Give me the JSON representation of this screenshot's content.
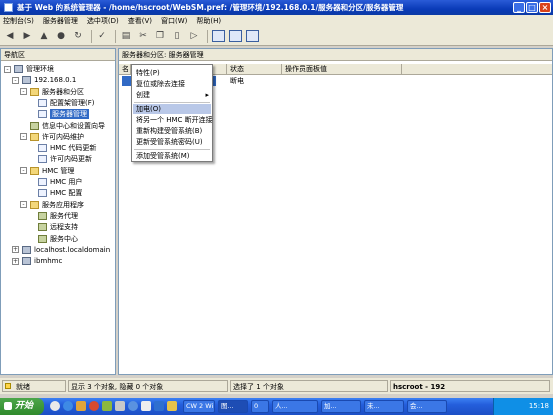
{
  "window": {
    "title": "基于 Web 的系统管理器 - /home/hscroot/WebSM.pref: /管理环境/192.168.0.1/服务器和分区/服务器管理"
  },
  "menubar": [
    "控制台(S)",
    "服务器管理",
    "选中项(D)",
    "查看(V)",
    "窗口(W)",
    "帮助(H)"
  ],
  "left_panel": {
    "header": "导航区",
    "tree": [
      {
        "label": "管理环境",
        "level": 0,
        "toggle": "-",
        "icon": "pc"
      },
      {
        "label": "192.168.0.1",
        "level": 1,
        "toggle": "-",
        "icon": "pc"
      },
      {
        "label": "服务器和分区",
        "level": 2,
        "toggle": "-",
        "icon": "folder"
      },
      {
        "label": "配置架管理(F)",
        "level": 3,
        "toggle": "",
        "icon": "doc"
      },
      {
        "label": "服务器管理",
        "level": 3,
        "toggle": "",
        "icon": "doc",
        "selected": true
      },
      {
        "label": "信息中心和设置向导",
        "level": 2,
        "toggle": "",
        "icon": "tool"
      },
      {
        "label": "许可内码维护",
        "level": 2,
        "toggle": "-",
        "icon": "folder"
      },
      {
        "label": "HMC 代码更新",
        "level": 3,
        "toggle": "",
        "icon": "doc"
      },
      {
        "label": "许可内码更新",
        "level": 3,
        "toggle": "",
        "icon": "doc"
      },
      {
        "label": "HMC 管理",
        "level": 2,
        "toggle": "-",
        "icon": "folder"
      },
      {
        "label": "HMC 用户",
        "level": 3,
        "toggle": "",
        "icon": "doc"
      },
      {
        "label": "HMC 配置",
        "level": 3,
        "toggle": "",
        "icon": "doc"
      },
      {
        "label": "服务应用程序",
        "level": 2,
        "toggle": "-",
        "icon": "folder"
      },
      {
        "label": "服务代理",
        "level": 3,
        "toggle": "",
        "icon": "tool"
      },
      {
        "label": "远程支持",
        "level": 3,
        "toggle": "",
        "icon": "tool"
      },
      {
        "label": "服务中心",
        "level": 3,
        "toggle": "",
        "icon": "tool"
      },
      {
        "label": "localhost.localdomain",
        "level": 1,
        "toggle": "+",
        "icon": "pc"
      },
      {
        "label": "ibmhmc",
        "level": 1,
        "toggle": "+",
        "icon": "pc"
      }
    ]
  },
  "right_panel": {
    "header": "服务器和分区: 服务器管理",
    "columns": [
      "名",
      "",
      "状态",
      "操作员面板值"
    ],
    "rows": [
      {
        "name": "",
        "status": "断电",
        "panel_value": ""
      }
    ]
  },
  "context_menu": [
    {
      "label": "特性(P)",
      "highlight": false,
      "sep_after": false,
      "arrow": false
    },
    {
      "label": "复位或除去连接",
      "highlight": false,
      "sep_after": false,
      "arrow": false
    },
    {
      "label": "创建",
      "highlight": false,
      "sep_after": true,
      "arrow": true
    },
    {
      "label": "加电(O)",
      "highlight": true,
      "sep_after": false,
      "arrow": false
    },
    {
      "label": "将另一个 HMC 断开连接",
      "highlight": false,
      "sep_after": false,
      "arrow": false
    },
    {
      "label": "重新构建受管系统(B)",
      "highlight": false,
      "sep_after": false,
      "arrow": false
    },
    {
      "label": "更新受管系统密码(U)",
      "highlight": false,
      "sep_after": true,
      "arrow": false
    },
    {
      "label": "添加受管系统(M)",
      "highlight": false,
      "sep_after": false,
      "arrow": false
    }
  ],
  "statusbar": {
    "ready": "就绪",
    "shown": "显示 3 个对象, 隐藏 0 个对象",
    "selected": "选择了 1 个对象",
    "user": "hscroot - 192"
  },
  "taskbar": {
    "start": "开始",
    "tasks": [
      "CW 2 Wi",
      "图...",
      "0",
      "人...",
      "加...",
      "未...",
      "会..."
    ],
    "clock": "15:18"
  }
}
